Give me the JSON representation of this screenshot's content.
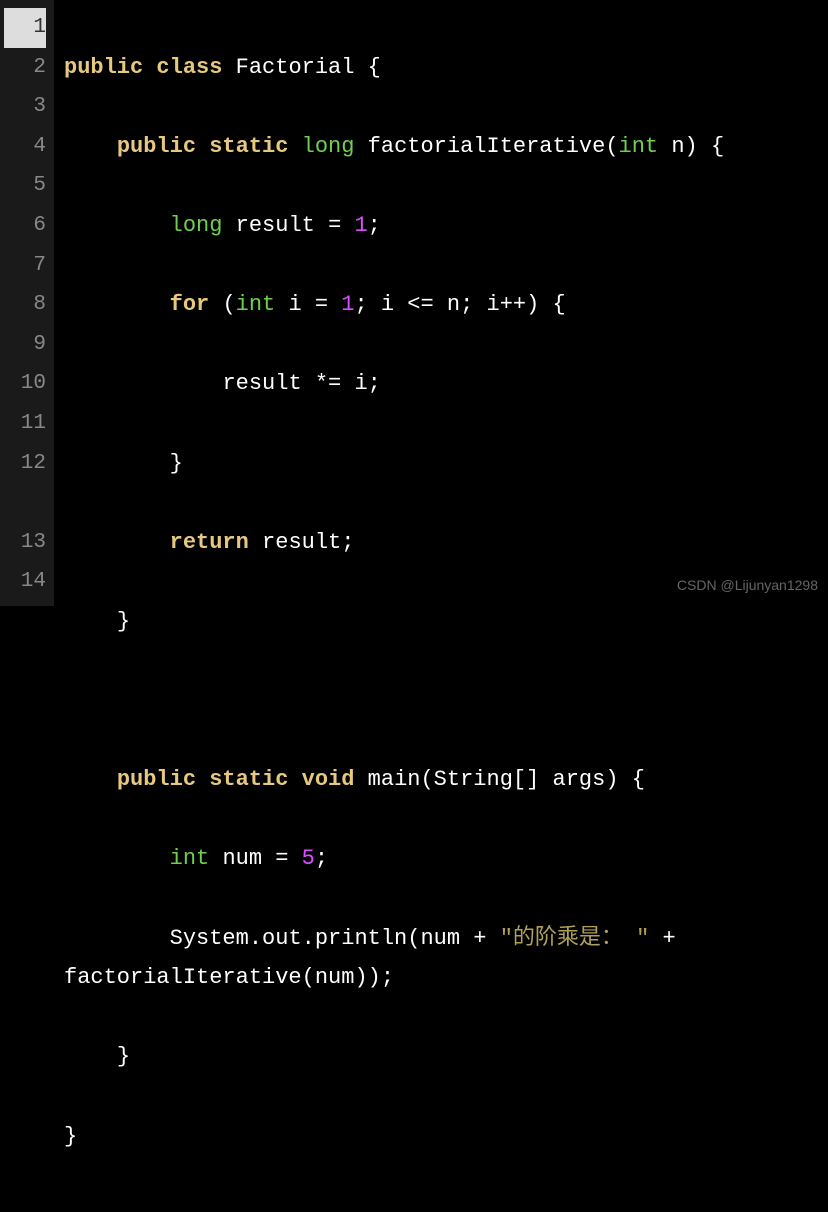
{
  "watermark": "CSDN @Lijunyan1298",
  "line_numbers": [
    "1",
    "2",
    "3",
    "4",
    "5",
    "6",
    "7",
    "8",
    "9",
    "10",
    "11",
    "12",
    "13",
    "14"
  ],
  "active_line": 1,
  "tokens": {
    "l1": {
      "kw1": "public",
      "kw2": "class",
      "name": "Factorial",
      "brace": "{"
    },
    "l2": {
      "kw1": "public",
      "kw2": "static",
      "type": "long",
      "fn": "factorialIterative",
      "paren_open": "(",
      "ptype": "int",
      "pname": "n",
      "paren_close": ")",
      "brace": "{"
    },
    "l3": {
      "type": "long",
      "name": "result",
      "assign": "=",
      "num": "1",
      "semi": ";"
    },
    "l4": {
      "kw": "for",
      "paren_open": "(",
      "type": "int",
      "init": "i =",
      "num": "1",
      "cond": "; i <= n; i++)",
      "brace": "{"
    },
    "l5": {
      "stmt": "result *= i;"
    },
    "l6": {
      "brace": "}"
    },
    "l7": {
      "kw": "return",
      "name": "result",
      "semi": ";"
    },
    "l8": {
      "brace": "}"
    },
    "l9": {
      "blank": ""
    },
    "l10": {
      "kw1": "public",
      "kw2": "static",
      "kw3": "void",
      "fn": "main",
      "args": "(String[] args)",
      "brace": "{"
    },
    "l11": {
      "type": "int",
      "name": "num",
      "assign": "=",
      "num": "5",
      "semi": ";"
    },
    "l12": {
      "pre": "System.out.println(num +",
      "str": "\"的阶乘是： \"",
      "post": "+ factorialIterative(num));"
    },
    "l13": {
      "brace": "}"
    },
    "l14": {
      "brace": "}"
    }
  }
}
